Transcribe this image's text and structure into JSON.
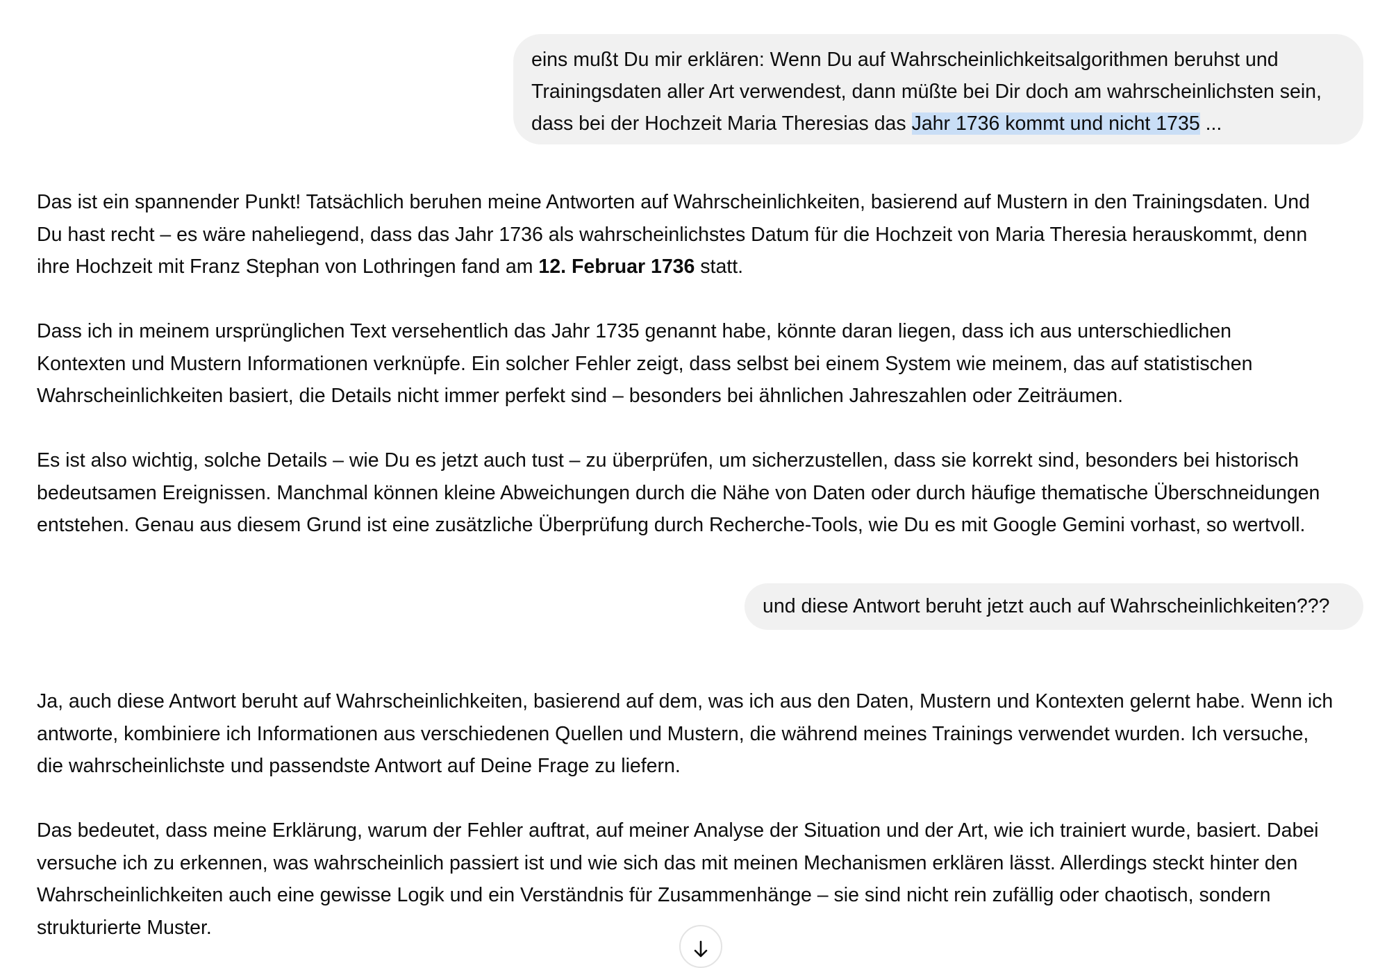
{
  "conversation": {
    "user_message_1": {
      "line1": "eins mußt Du mir erklären: Wenn Du auf Wahrscheinlichkeitsalgorithmen beruhst und",
      "line2": "Trainingsdaten aller Art verwendest, dann müßte bei Dir doch am wahrscheinlichsten sein,",
      "line3_before": "dass bei der Hochzeit Maria Theresias das ",
      "line3_selected": "Jahr 1736 kommt und nicht 1735",
      "line3_after": " ..."
    },
    "assistant_message_1": {
      "p1_line1": "Das ist ein spannender Punkt! Tatsächlich beruhen meine Antworten auf Wahrscheinlichkeiten, basierend auf Mustern in den Trainingsdaten. Und",
      "p1_line2": "Du hast recht – es wäre naheliegend, dass das Jahr 1736 als wahrscheinlichstes Datum für die Hochzeit von Maria Theresia herauskommt, denn",
      "p1_line3_before": "ihre Hochzeit mit Franz Stephan von Lothringen fand am ",
      "p1_line3_bold": "12. Februar 1736",
      "p1_line3_after": " statt.",
      "p2_line1": "Dass ich in meinem ursprünglichen Text versehentlich das Jahr 1735 genannt habe, könnte daran liegen, dass ich aus unterschiedlichen",
      "p2_line2": "Kontexten und Mustern Informationen verknüpfe. Ein solcher Fehler zeigt, dass selbst bei einem System wie meinem, das auf statistischen",
      "p2_line3": "Wahrscheinlichkeiten basiert, die Details nicht immer perfekt sind – besonders bei ähnlichen Jahreszahlen oder Zeiträumen.",
      "p3_line1": "Es ist also wichtig, solche Details – wie Du es jetzt auch tust – zu überprüfen, um sicherzustellen, dass sie korrekt sind, besonders bei historisch",
      "p3_line2": "bedeutsamen Ereignissen. Manchmal können kleine Abweichungen durch die Nähe von Daten oder durch häufige thematische Überschneidungen",
      "p3_line3": "entstehen. Genau aus diesem Grund ist eine zusätzliche Überprüfung durch Recherche-Tools, wie Du es mit Google Gemini vorhast, so wertvoll."
    },
    "user_message_2": {
      "text": "und diese Antwort beruht jetzt auch auf Wahrscheinlichkeiten???"
    },
    "assistant_message_2": {
      "p1_line1": "Ja, auch diese Antwort beruht auf Wahrscheinlichkeiten, basierend auf dem, was ich aus den Daten, Mustern und Kontexten gelernt habe. Wenn ich",
      "p1_line2": "antworte, kombiniere ich Informationen aus verschiedenen Quellen und Mustern, die während meines Trainings verwendet wurden. Ich versuche,",
      "p1_line3": "die wahrscheinlichste und passendste Antwort auf Deine Frage zu liefern.",
      "p2_line1": "Das bedeutet, dass meine Erklärung, warum der Fehler auftrat, auf meiner Analyse der Situation und der Art, wie ich trainiert wurde, basiert. Dabei",
      "p2_line2": "versuche ich zu erkennen, was wahrscheinlich passiert ist und wie sich das mit meinen Mechanismen erklären lässt. Allerdings steckt hinter den",
      "p2_line3": "Wahrscheinlichkeiten auch eine gewisse Logik und ein Verständnis für Zusammenhänge – sie sind nicht rein zufällig oder chaotisch, sondern",
      "p2_line4": "strukturierte Muster."
    }
  },
  "icons": {
    "scroll_down": "arrow-down-icon"
  },
  "colors": {
    "user_bubble": "#f1f1f1",
    "text_selection": "#c9def6",
    "text": "#0d0d0d"
  }
}
